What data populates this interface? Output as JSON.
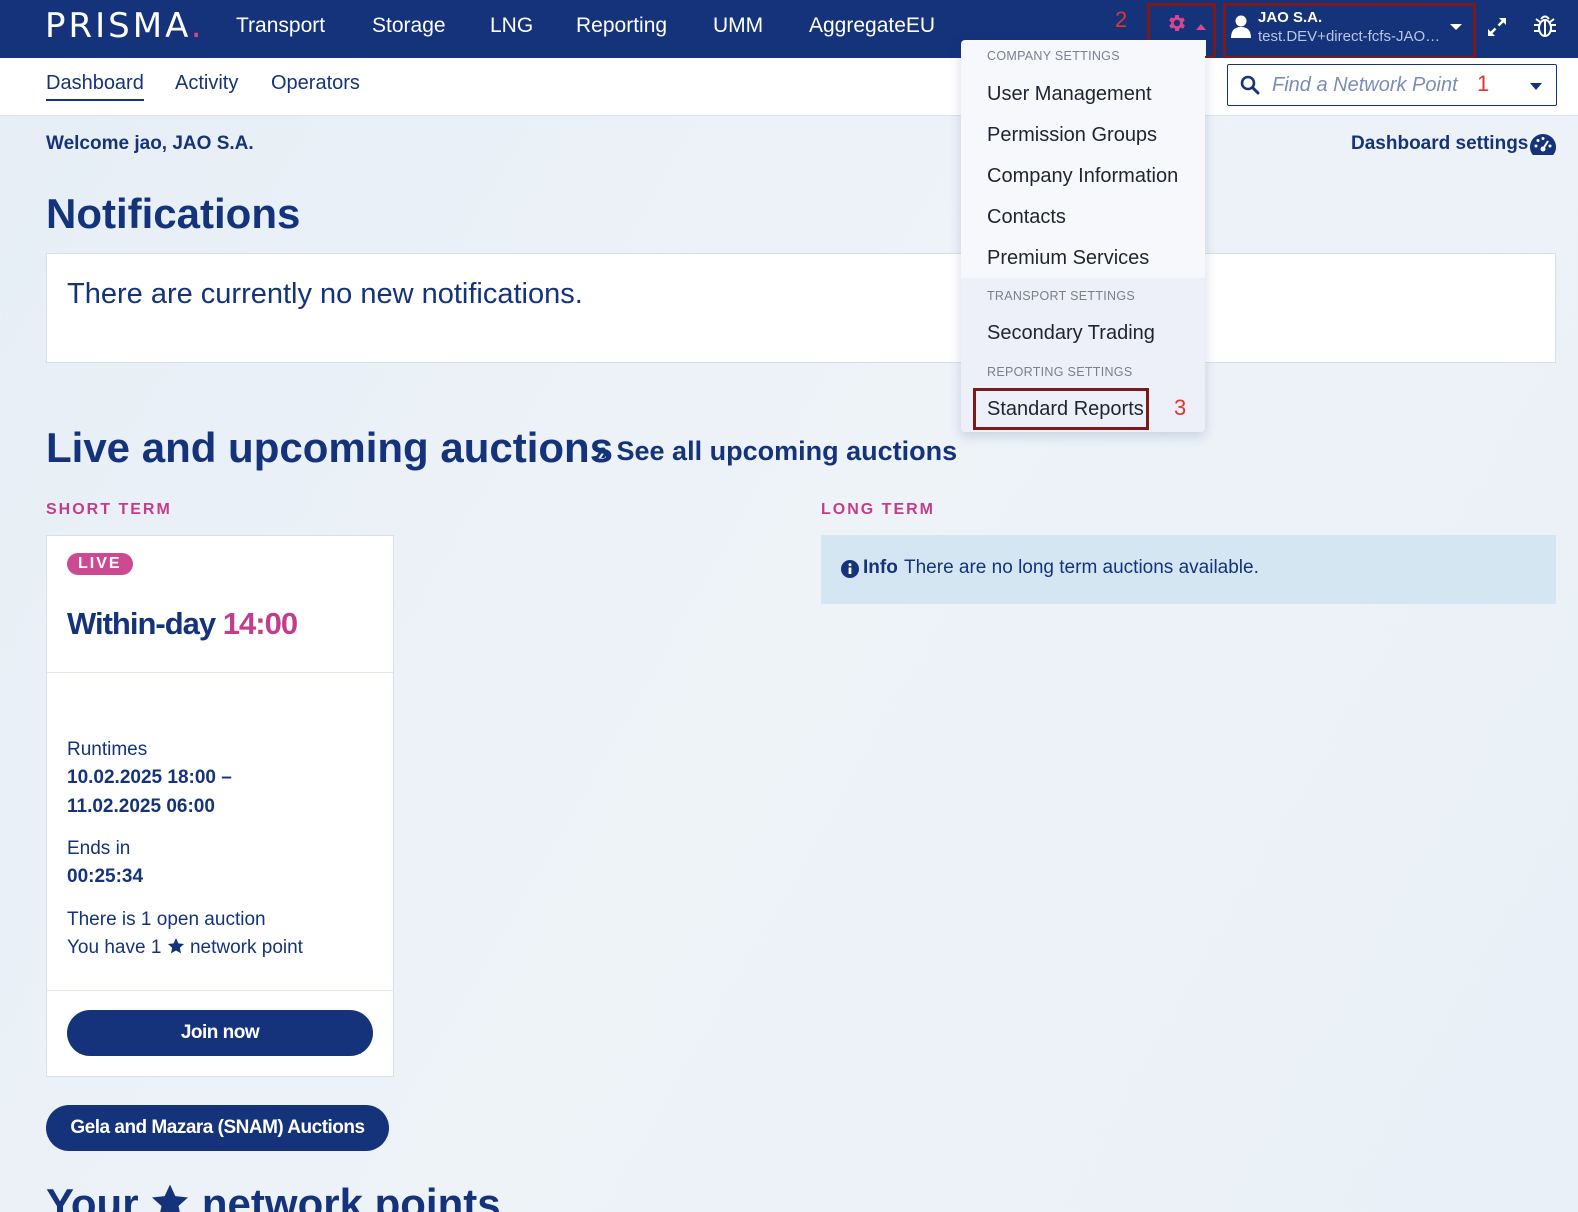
{
  "brand": {
    "name": "PRISMA",
    "dot": "."
  },
  "topnav": {
    "items": [
      "Transport",
      "Storage",
      "LNG",
      "Reporting",
      "UMM",
      "AggregateEU"
    ]
  },
  "user": {
    "company": "JAO S.A.",
    "email": "test.DEV+direct-fcfs-JAO…"
  },
  "annotations": {
    "one": "1",
    "two": "2",
    "three": "3"
  },
  "subnav": {
    "items": [
      "Dashboard",
      "Activity",
      "Operators"
    ]
  },
  "search": {
    "placeholder": "Find a Network Point"
  },
  "welcome": "Welcome jao, JAO S.A.",
  "dashboard_settings": "Dashboard settings",
  "notifications": {
    "title": "Notifications",
    "empty_text": "There are currently no new notifications."
  },
  "auctions": {
    "title": "Live and upcoming auctions",
    "see_all": "» See all upcoming auctions",
    "short_term_label": "SHORT TERM",
    "long_term_label": "LONG TERM",
    "card": {
      "badge": "LIVE",
      "title": "Within-day",
      "time": "14:00",
      "runtimes_label": "Runtimes",
      "runtime_start": "10.02.2025 18:00 –",
      "runtime_end": "11.02.2025 06:00",
      "ends_label": "Ends in",
      "ends_value": "00:25:34",
      "open_auctions": "There is 1 open auction",
      "network_points_pre": "You have 1",
      "network_points_post": "network point",
      "join_label": "Join now"
    },
    "gela_button": "Gela and Mazara (SNAM) Auctions",
    "info_strong": "Info",
    "info_text": "There are no long term auctions available."
  },
  "your_network_points": {
    "pre": "Your",
    "post": "network points"
  },
  "settings_menu": {
    "company_header": "COMPANY SETTINGS",
    "company_items": [
      "User Management",
      "Permission Groups",
      "Company Information",
      "Contacts",
      "Premium Services"
    ],
    "transport_header": "TRANSPORT SETTINGS",
    "transport_items": [
      "Secondary Trading"
    ],
    "reporting_header": "REPORTING SETTINGS",
    "reporting_items": [
      "Standard Reports"
    ]
  },
  "colors": {
    "navy": "#14337a",
    "accent_pink": "#c23d8a",
    "annotation_red": "#e2352f",
    "info_bg": "#d5e6f3"
  }
}
